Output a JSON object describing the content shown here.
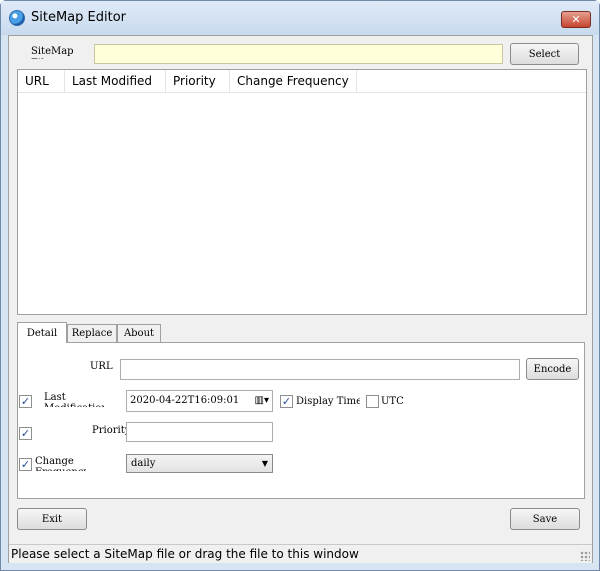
{
  "window": {
    "title": "SiteMap Editor",
    "close_glyph": "✕"
  },
  "file": {
    "label": "SiteMap File",
    "value": "",
    "select_label": "Select"
  },
  "list": {
    "columns": [
      "URL",
      "Last Modified",
      "Priority",
      "Change Frequency"
    ]
  },
  "tabs": [
    {
      "label": "Detail",
      "active": true
    },
    {
      "label": "Replace",
      "active": false
    },
    {
      "label": "About",
      "active": false
    }
  ],
  "detail": {
    "url_label": "URL",
    "url_value": "",
    "encode_label": "Encode",
    "last_modified_label": "Last Modification",
    "last_modified_checked": true,
    "last_modified_value": "2020-04-22T16:09:01",
    "display_time_label": "Display Time",
    "display_time_checked": true,
    "utc_label": "UTC",
    "utc_checked": false,
    "priority_label": "Priority",
    "priority_checked": true,
    "priority_value": "",
    "change_freq_label": "Change Frequency",
    "change_freq_checked": true,
    "change_freq_value": "daily"
  },
  "footer": {
    "exit_label": "Exit",
    "save_label": "Save"
  },
  "status": {
    "text": "Please select a SiteMap file or drag the file to this window"
  }
}
